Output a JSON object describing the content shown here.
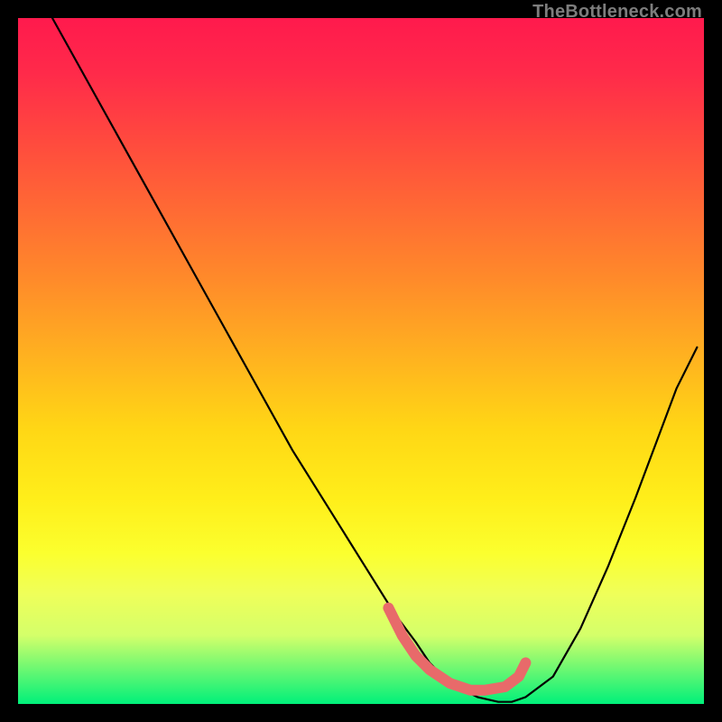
{
  "watermark": {
    "text": "TheBottleneck.com"
  },
  "chart_data": {
    "type": "line",
    "title": "",
    "xlabel": "",
    "ylabel": "",
    "xlim": [
      0,
      100
    ],
    "ylim": [
      0,
      100
    ],
    "grid": false,
    "legend": false,
    "series": [
      {
        "name": "curve",
        "x": [
          5,
          10,
          15,
          20,
          25,
          30,
          35,
          40,
          45,
          50,
          55,
          58,
          60,
          62,
          65,
          67,
          70,
          72,
          74,
          78,
          82,
          86,
          90,
          93,
          96,
          99
        ],
        "y": [
          100,
          91,
          82,
          73,
          64,
          55,
          46,
          37,
          29,
          21,
          13,
          9,
          6,
          4,
          2,
          1,
          0.3,
          0.3,
          1,
          4,
          11,
          20,
          30,
          38,
          46,
          52
        ]
      },
      {
        "name": "marker",
        "x": [
          54,
          56,
          58,
          60,
          63,
          66,
          68,
          71,
          73,
          74
        ],
        "y": [
          14,
          10,
          7,
          5,
          3,
          2,
          2,
          2.5,
          4,
          6
        ]
      }
    ]
  }
}
